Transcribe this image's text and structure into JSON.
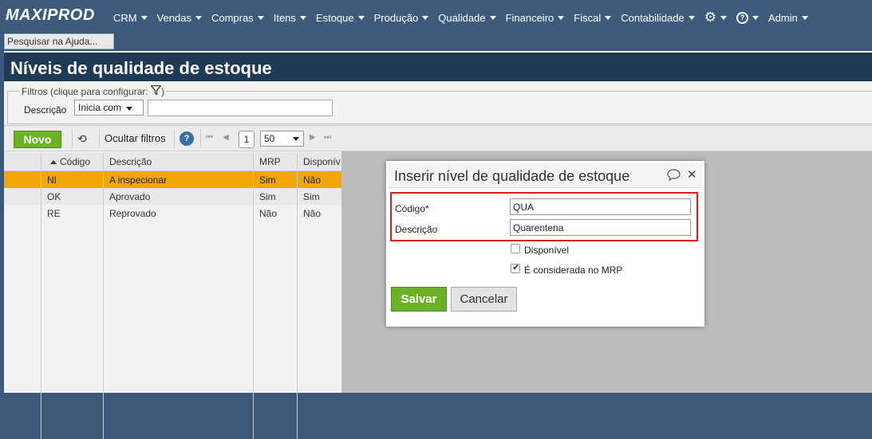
{
  "app": {
    "logo": "MAXIPROD"
  },
  "nav": {
    "items": [
      "CRM",
      "Vendas",
      "Compras",
      "Itens",
      "Estoque",
      "Produção",
      "Qualidade",
      "Financeiro",
      "Fiscal",
      "Contabilidade"
    ],
    "settings_icon": "gear-icon",
    "help_icon": "help-circle-icon",
    "help_glyph": "?",
    "user": "Admin"
  },
  "help_search": {
    "placeholder": "Pesquisar na Ajuda..."
  },
  "page": {
    "title": "Níveis de qualidade de estoque"
  },
  "filters": {
    "legend": "Filtros (clique para configurar:",
    "legend_close": ")",
    "field_label": "Descrição",
    "operator": "Inicia com",
    "value": ""
  },
  "toolbar": {
    "new_label": "Novo",
    "hide_filters_label": "Ocultar filtros",
    "help_glyph": "?",
    "page_number": "1",
    "page_size": "50"
  },
  "table": {
    "columns": [
      "Código",
      "Descrição",
      "MRP",
      "Disponív"
    ],
    "rows": [
      {
        "codigo": "NI",
        "descricao": "A inspecionar",
        "mrp": "Sim",
        "disponivel": "Não",
        "selected": true
      },
      {
        "codigo": "OK",
        "descricao": "Aprovado",
        "mrp": "Sim",
        "disponivel": "Sim",
        "selected": false
      },
      {
        "codigo": "RE",
        "descricao": "Reprovado",
        "mrp": "Não",
        "disponivel": "Não",
        "selected": false
      }
    ]
  },
  "dialog": {
    "title": "Inserir nível de qualidade de estoque",
    "fields": {
      "codigo_label": "Código*",
      "codigo_value": "QUA",
      "descricao_label": "Descrição",
      "descricao_value": "Quarentena"
    },
    "checkboxes": {
      "disponivel_label": "Disponível",
      "disponivel_checked": false,
      "mrp_label": "É considerada no MRP",
      "mrp_checked": true
    },
    "save_label": "Salvar",
    "cancel_label": "Cancelar"
  },
  "colors": {
    "nav_bg": "#3d5b7c",
    "title_bg": "#1f3a54",
    "accent_green": "#6bb324",
    "selected_row": "#f0a800",
    "highlight_red": "#d42020"
  }
}
